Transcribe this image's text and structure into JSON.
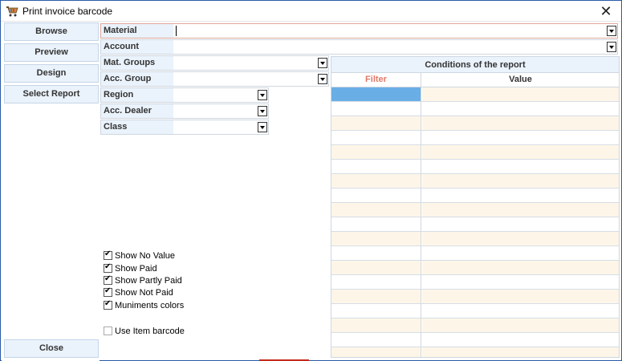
{
  "window": {
    "title": "Print invoice barcode",
    "close_symbol": "✕"
  },
  "sidebar": {
    "buttons": [
      {
        "label": "Browse"
      },
      {
        "label": "Preview"
      },
      {
        "label": "Design"
      },
      {
        "label": "Select Report"
      }
    ],
    "close_label": "Close"
  },
  "fields": {
    "material": {
      "label": "Material",
      "value": ""
    },
    "account": {
      "label": "Account",
      "value": ""
    },
    "mat_groups": {
      "label": "Mat. Groups",
      "value": ""
    },
    "acc_group": {
      "label": "Acc. Group",
      "value": ""
    },
    "region": {
      "label": "Region",
      "value": ""
    },
    "acc_dealer": {
      "label": "Acc. Dealer",
      "value": ""
    },
    "class": {
      "label": "Class",
      "value": ""
    }
  },
  "conditions": {
    "title": "Conditions of the report",
    "columns": [
      "Filter",
      "Value"
    ],
    "selected_row": 0
  },
  "options": [
    {
      "label": "Show No Value",
      "checked": true
    },
    {
      "label": "Show Paid",
      "checked": true
    },
    {
      "label": "Show Partly Paid",
      "checked": true
    },
    {
      "label": "Show Not Paid",
      "checked": true
    },
    {
      "label": "Muniments colors",
      "checked": true
    },
    {
      "label": "Use Item barcode",
      "checked": false
    }
  ],
  "colors": {
    "panel_bg": "#eaf2fb",
    "row_tint": "#fdf6e8",
    "selected_cell": "#6aaee6",
    "filter_header": "#e07a6a",
    "accent": "#c42b1c"
  }
}
